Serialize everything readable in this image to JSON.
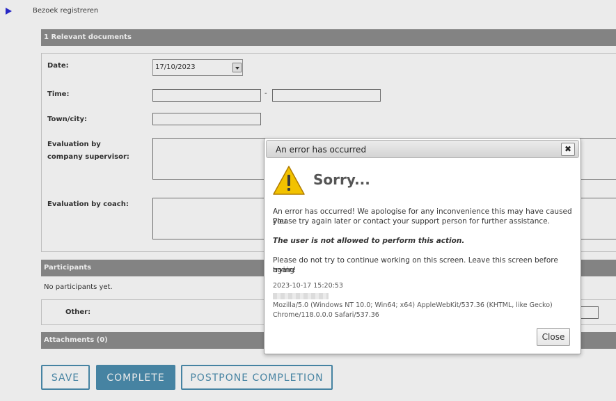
{
  "breadcrumb": {
    "label": "Bezoek registreren"
  },
  "sections": {
    "relevant_documents": "1 Relevant documents",
    "participants": "Participants",
    "attachments": "Attachments (0)"
  },
  "form": {
    "date_label": "Date:",
    "date_value": "17/10/2023",
    "time_label": "Time:",
    "time_separator": "-",
    "town_label": "Town/city:",
    "eval_supervisor_label_line1": "Evaluation by",
    "eval_supervisor_label_line2": "company supervisor:",
    "eval_coach_label": "Evaluation by coach:"
  },
  "participants": {
    "empty_text": "No participants yet.",
    "other_label": "Other:"
  },
  "buttons": {
    "save": "SAVE",
    "complete": "COMPLETE",
    "postpone": "POSTPONE COMPLETION"
  },
  "dialog": {
    "title": "An error has occurred",
    "close_x": "✖",
    "heading": "Sorry...",
    "message_line1": "An error has occurred! We apologise for any inconvenience this may have caused you.",
    "message_line2": "Please try again later or contact your support person for further assistance.",
    "error_detail": "The user is not allowed to perform this action.",
    "advice_line1": "Please do not try to continue working on this screen. Leave this screen before trying",
    "advice_line2": "again!",
    "timestamp": "2023-10-17 15:20:53",
    "user_agent_line1": "Mozilla/5.0 (Windows NT 10.0; Win64; x64) AppleWebKit/537.36 (KHTML, like Gecko)",
    "user_agent_line2": "Chrome/118.0.0.0 Safari/537.36",
    "close_button": "Close"
  },
  "colors": {
    "section_bar": "#8f8f8f",
    "button_accent": "#4d8fb0",
    "breadcrumb_arrow": "#2b2bd6",
    "warning_yellow": "#f2c200"
  }
}
